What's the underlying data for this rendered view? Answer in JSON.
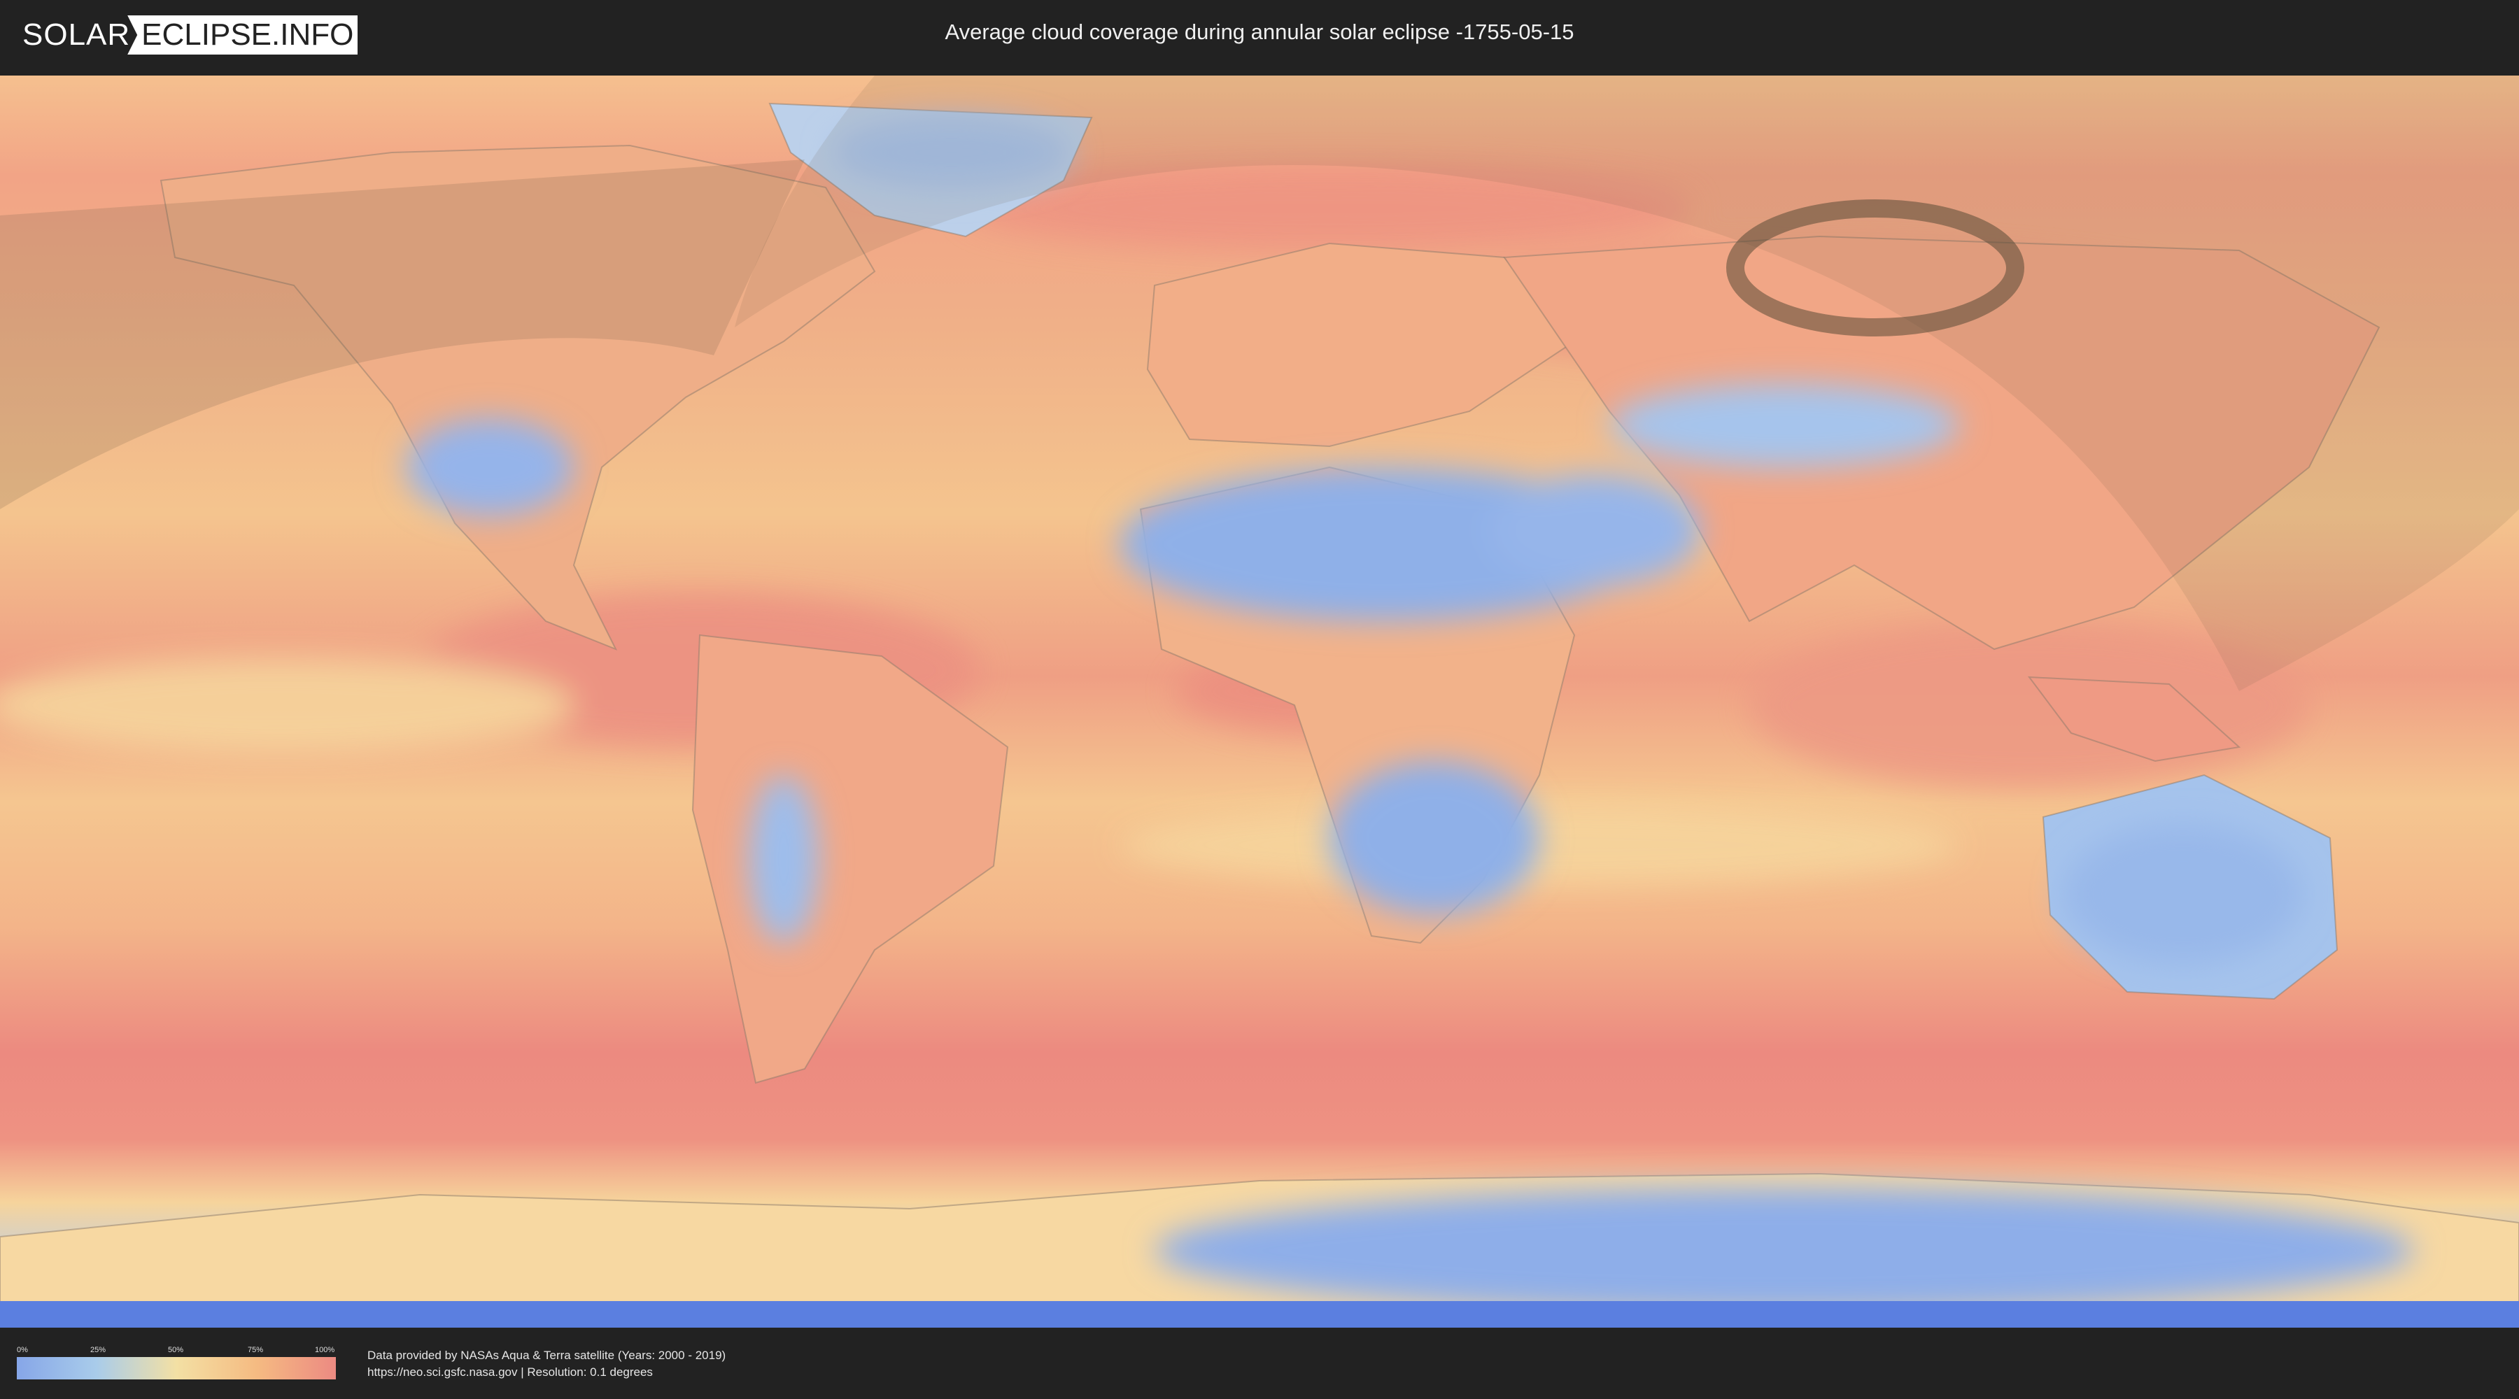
{
  "header": {
    "logo_solar": "SOLAR",
    "logo_eclipse": "ECLIPSE.INFO",
    "title": "Average cloud coverage during annular solar eclipse -1755-05-15"
  },
  "legend": {
    "ticks": [
      "0%",
      "25%",
      "50%",
      "75%",
      "100%"
    ],
    "colors": [
      "#86a6e8",
      "#a9ccea",
      "#f3e0a4",
      "#f5bb82",
      "#ec8a82"
    ]
  },
  "footer": {
    "source_line": "Data provided by NASAs Aqua & Terra satellite (Years: 2000 - 2019)",
    "info_line": "https://neo.sci.gsfc.nasa.gov | Resolution: 0.1 degrees"
  },
  "map": {
    "colors": {
      "ocean_cloudy": "#ec8e82",
      "ocean_mid": "#f4c08c",
      "dry_land": "#8fb0e8",
      "antarctica": "#a8c4ef",
      "eclipse_shade": "#6b5a44"
    }
  }
}
